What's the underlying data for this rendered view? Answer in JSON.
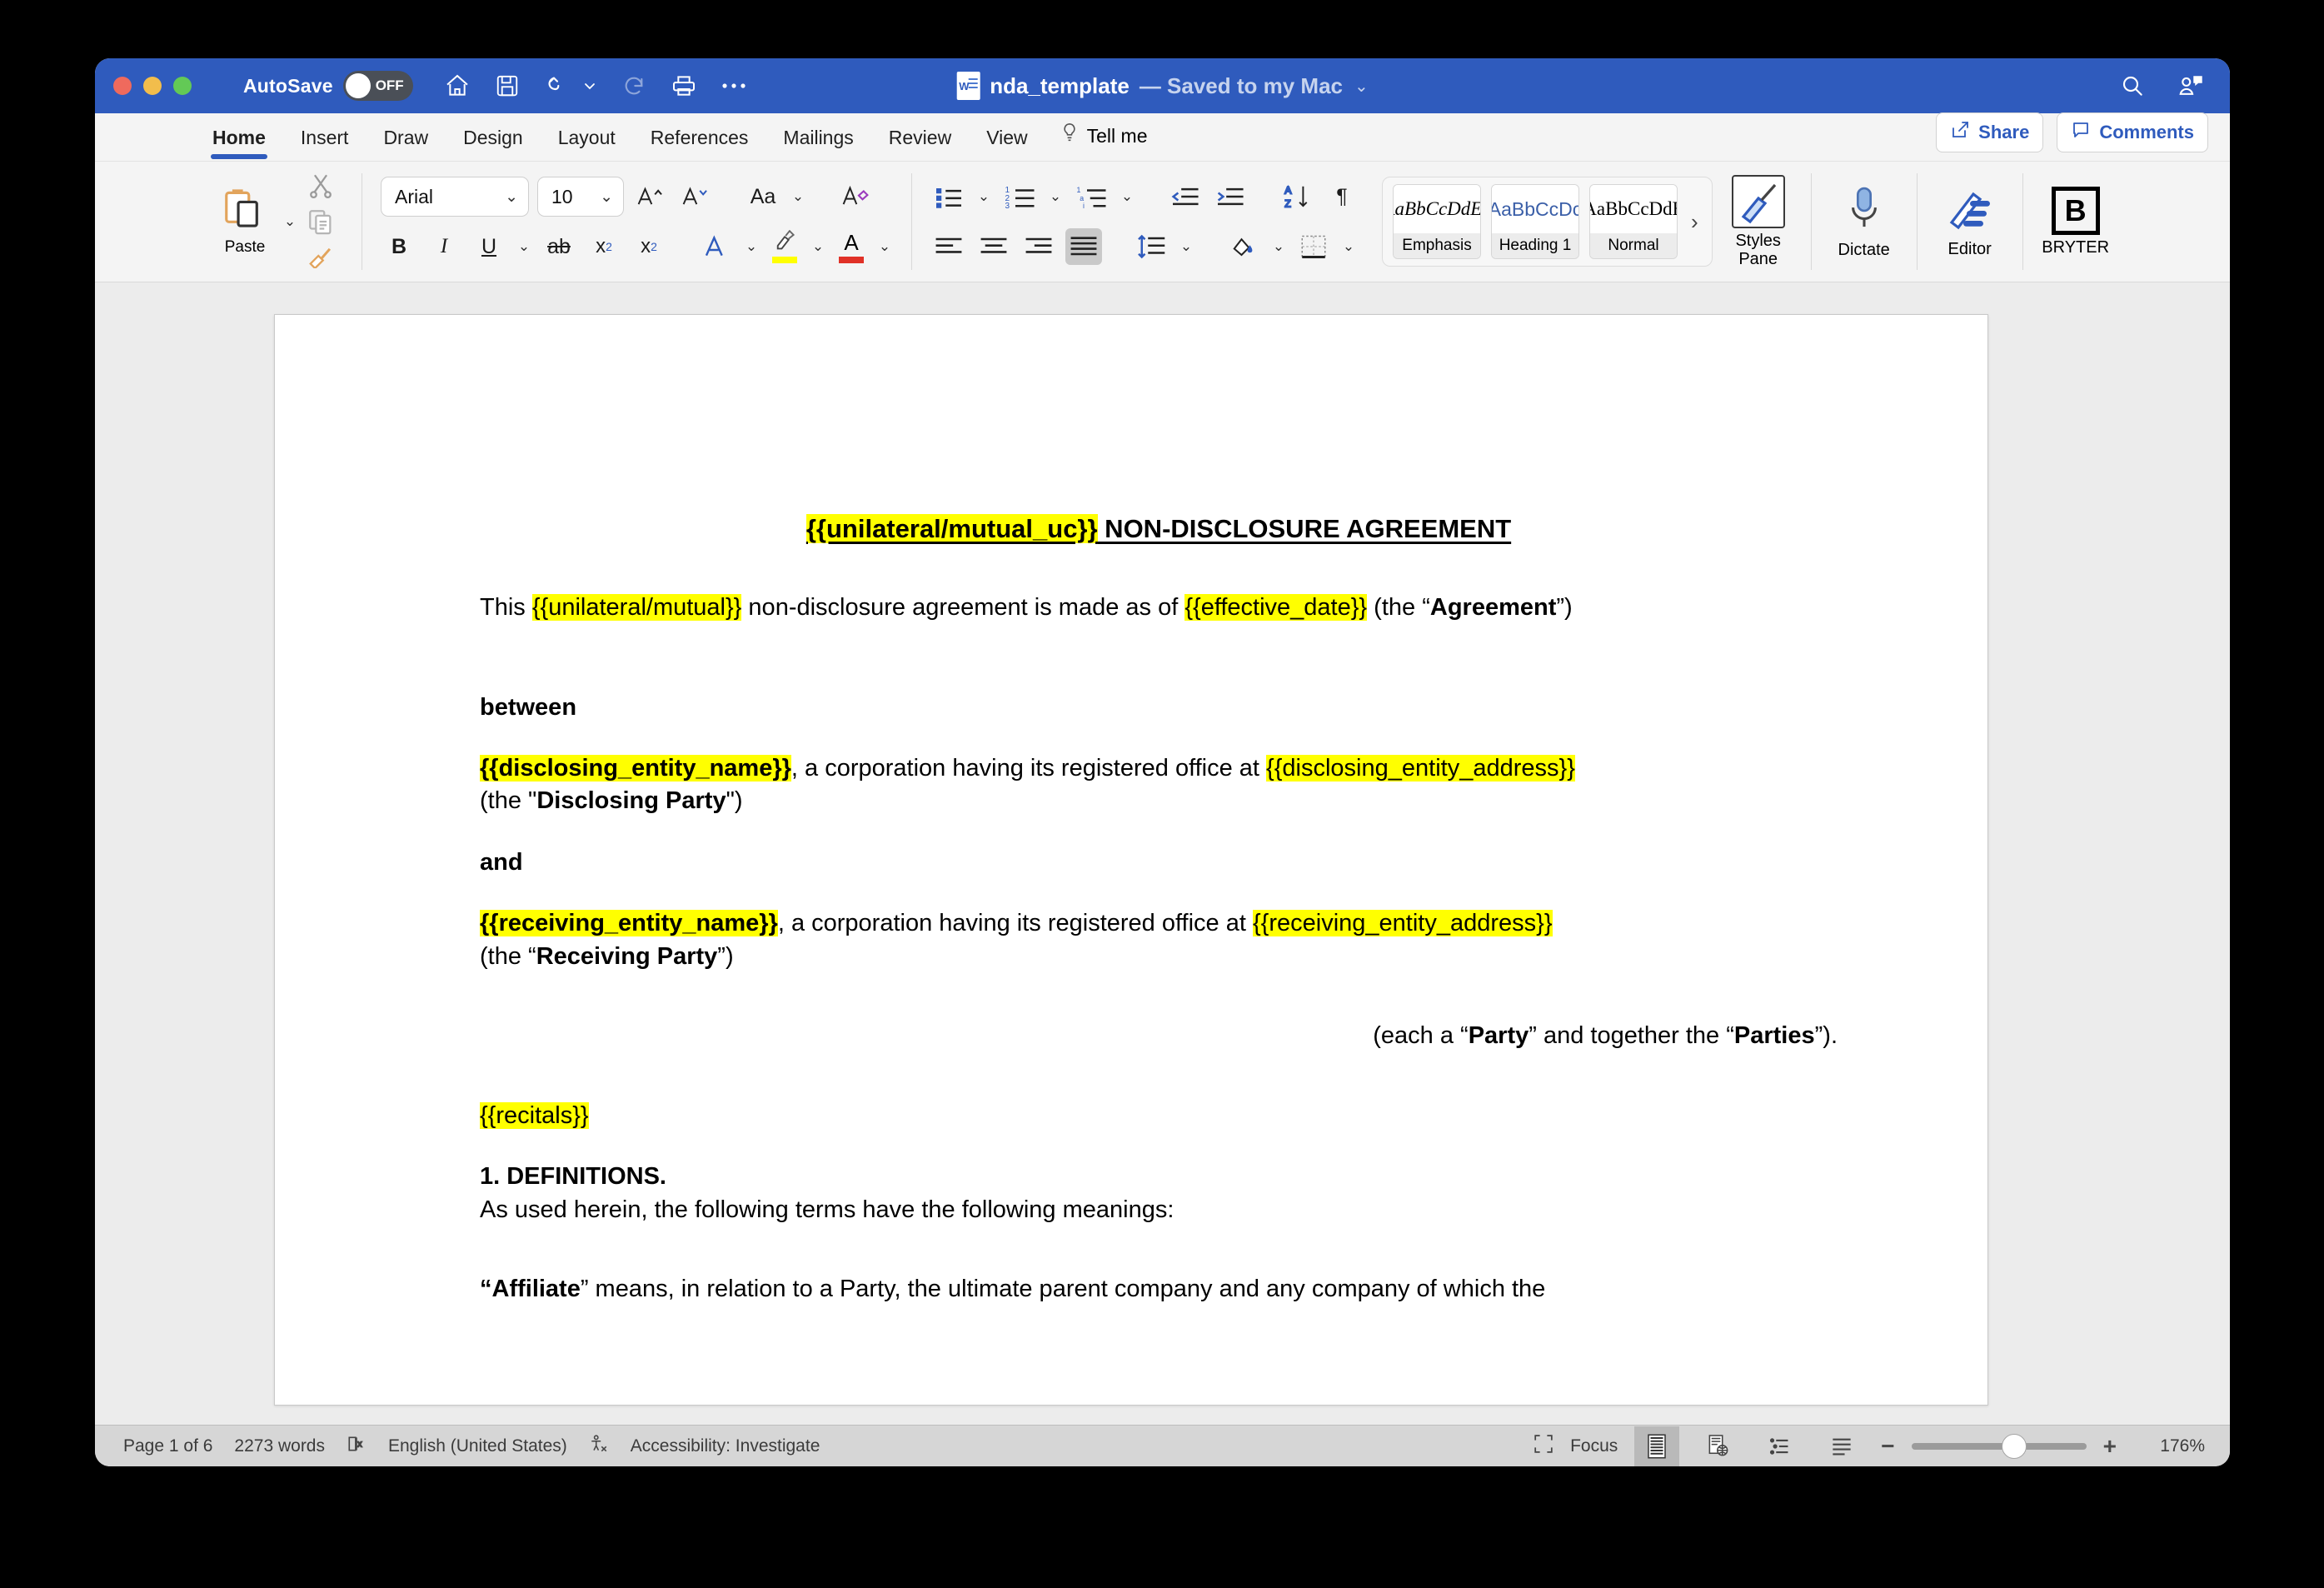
{
  "window": {
    "titlebar": {
      "autosave_label": "AutoSave",
      "autosave_state": "OFF",
      "document_name": "nda_template",
      "document_status": "— Saved to my Mac",
      "quick_access": [
        {
          "name": "home-icon",
          "label": "Home"
        },
        {
          "name": "save-icon",
          "label": "Save"
        },
        {
          "name": "undo-icon",
          "label": "Undo"
        },
        {
          "name": "redo-icon",
          "label": "Redo"
        },
        {
          "name": "print-icon",
          "label": "Print"
        },
        {
          "name": "more-icon",
          "label": "More"
        }
      ],
      "right_icons": [
        {
          "name": "search-icon",
          "label": "Search"
        },
        {
          "name": "account-comment-icon",
          "label": "Account"
        }
      ]
    },
    "tabs": [
      {
        "label": "Home",
        "active": true
      },
      {
        "label": "Insert",
        "active": false
      },
      {
        "label": "Draw",
        "active": false
      },
      {
        "label": "Design",
        "active": false
      },
      {
        "label": "Layout",
        "active": false
      },
      {
        "label": "References",
        "active": false
      },
      {
        "label": "Mailings",
        "active": false
      },
      {
        "label": "Review",
        "active": false
      },
      {
        "label": "View",
        "active": false
      }
    ],
    "tell_me": "Tell me",
    "share_button": "Share",
    "comments_button": "Comments",
    "ribbon": {
      "paste_label": "Paste",
      "font_family_value": "Arial",
      "font_size_value": "10",
      "styles": [
        {
          "preview": "AaBbCcDdEe",
          "name": "Emphasis"
        },
        {
          "preview": "AaBbCcDc",
          "name": "Heading 1"
        },
        {
          "preview": "AaBbCcDdE",
          "name": "Normal"
        }
      ],
      "styles_pane_label_1": "Styles",
      "styles_pane_label_2": "Pane",
      "dictate_label": "Dictate",
      "editor_label": "Editor",
      "bryter_label": "BRYTER",
      "bryter_glyph": "B"
    }
  },
  "document": {
    "title": {
      "placeholder": "{{unilateral/mutual_uc}}",
      "rest": " NON-DISCLOSURE AGREEMENT"
    },
    "intro": {
      "t1": "This ",
      "ph1": "{{unilateral/mutual}}",
      "t2": " non-disclosure agreement is made as of ",
      "ph2": "{{effective_date}}",
      "t3": " (the “",
      "bold1": "Agreement",
      "t4": "”)"
    },
    "between_label": "between",
    "disclosing": {
      "ph_name": "{{disclosing_entity_name}}",
      "t1": ", a corporation having its registered office at ",
      "ph_addr": "{{disclosing_entity_address}}",
      "t2": "(the \"",
      "bold": "Disclosing Party",
      "t3": "\")"
    },
    "and_label": "and",
    "receiving": {
      "ph_name": "{{receiving_entity_name}}",
      "t1": ", a corporation having its registered office at ",
      "ph_addr": "{{receiving_entity_address}}",
      "t2": "(the “",
      "bold": "Receiving Party",
      "t3": "”)"
    },
    "parties_line": {
      "t1": "(each a “",
      "b1": "Party",
      "t2": "” and together the “",
      "b2": "Parties",
      "t3": "”)."
    },
    "recitals_placeholder": "{{recitals}}",
    "definitions_heading": "1. DEFINITIONS.",
    "definitions_intro": "As used herein, the following terms have the following meanings:",
    "affiliate": {
      "b": "“Affiliate",
      "t": "” means, in relation to a Party, the ultimate parent company and any company of which the"
    }
  },
  "statusbar": {
    "page": "Page 1 of 6",
    "words": "2273 words",
    "language": "English (United States)",
    "accessibility": "Accessibility: Investigate",
    "focus": "Focus",
    "zoom": "176%"
  },
  "colors": {
    "titlebar": "#2f5bbd",
    "accent": "#2f5bbd",
    "highlight": "#ffff00",
    "statusbar": "#d6d6d6",
    "canvas": "#ececec"
  }
}
